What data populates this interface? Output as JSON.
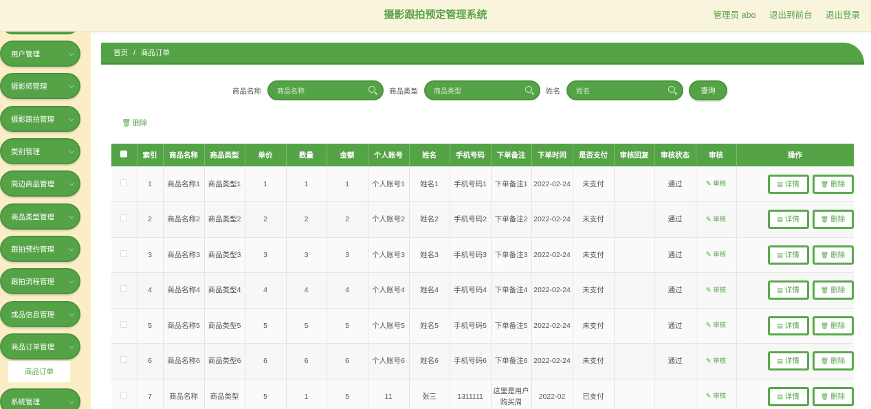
{
  "header": {
    "title": "摄影跟拍预定管理系统",
    "admin_label": "管理员 abo",
    "exit_front": "退出到前台",
    "logout": "退出登录"
  },
  "sidebar": {
    "items": [
      {
        "label": "用户管理"
      },
      {
        "label": "摄影师管理"
      },
      {
        "label": "摄影跟拍管理"
      },
      {
        "label": "类别管理"
      },
      {
        "label": "周边商品管理"
      },
      {
        "label": "商品类型管理"
      },
      {
        "label": "跟拍预约管理"
      },
      {
        "label": "跟拍流程管理"
      },
      {
        "label": "成品信息管理"
      },
      {
        "label": "商品订单管理"
      },
      {
        "label": "系统管理"
      }
    ],
    "active_sub": "商品订单"
  },
  "breadcrumb": {
    "home": "首页",
    "sep": "/",
    "current": "商品订单"
  },
  "search": {
    "name_label": "商品名称",
    "name_placeholder": "商品名称",
    "type_label": "商品类型",
    "type_placeholder": "商品类型",
    "person_label": "姓名",
    "person_placeholder": "姓名",
    "query_button": "查询"
  },
  "toolbar": {
    "delete_label": "删除"
  },
  "table": {
    "headers": [
      "索引",
      "商品名称",
      "商品类型",
      "单价",
      "数量",
      "金额",
      "个人账号",
      "姓名",
      "手机号码",
      "下单备注",
      "下单时间",
      "是否支付",
      "审核回复",
      "审核状态",
      "审核",
      "操作"
    ],
    "audit_label": "审核",
    "detail_label": "详情",
    "delete_label": "删除",
    "rows": [
      {
        "idx": "1",
        "name": "商品名称1",
        "type": "商品类型1",
        "price": "1",
        "qty": "1",
        "amount": "1",
        "account": "个人账号1",
        "person": "姓名1",
        "phone": "手机号码1",
        "note": "下单备注1",
        "time": "2022-02-24",
        "paid": "未支付",
        "reply": "",
        "status": "通过"
      },
      {
        "idx": "2",
        "name": "商品名称2",
        "type": "商品类型2",
        "price": "2",
        "qty": "2",
        "amount": "2",
        "account": "个人账号2",
        "person": "姓名2",
        "phone": "手机号码2",
        "note": "下单备注2",
        "time": "2022-02-24",
        "paid": "未支付",
        "reply": "",
        "status": "通过"
      },
      {
        "idx": "3",
        "name": "商品名称3",
        "type": "商品类型3",
        "price": "3",
        "qty": "3",
        "amount": "3",
        "account": "个人账号3",
        "person": "姓名3",
        "phone": "手机号码3",
        "note": "下单备注3",
        "time": "2022-02-24",
        "paid": "未支付",
        "reply": "",
        "status": "通过"
      },
      {
        "idx": "4",
        "name": "商品名称4",
        "type": "商品类型4",
        "price": "4",
        "qty": "4",
        "amount": "4",
        "account": "个人账号4",
        "person": "姓名4",
        "phone": "手机号码4",
        "note": "下单备注4",
        "time": "2022-02-24",
        "paid": "未支付",
        "reply": "",
        "status": "通过"
      },
      {
        "idx": "5",
        "name": "商品名称5",
        "type": "商品类型5",
        "price": "5",
        "qty": "5",
        "amount": "5",
        "account": "个人账号5",
        "person": "姓名5",
        "phone": "手机号码5",
        "note": "下单备注5",
        "time": "2022-02-24",
        "paid": "未支付",
        "reply": "",
        "status": "通过"
      },
      {
        "idx": "6",
        "name": "商品名称6",
        "type": "商品类型6",
        "price": "6",
        "qty": "6",
        "amount": "6",
        "account": "个人账号6",
        "person": "姓名6",
        "phone": "手机号码6",
        "note": "下单备注6",
        "time": "2022-02-24",
        "paid": "未支付",
        "reply": "",
        "status": "通过"
      },
      {
        "idx": "7",
        "name": "商品名称",
        "type": "商品类型",
        "price": "5",
        "qty": "1",
        "amount": "5",
        "account": "11",
        "person": "张三",
        "phone": "1311111",
        "note": "这里是用户购买周",
        "time": "2022-02",
        "paid": "已支付",
        "reply": "",
        "status": ""
      }
    ]
  }
}
